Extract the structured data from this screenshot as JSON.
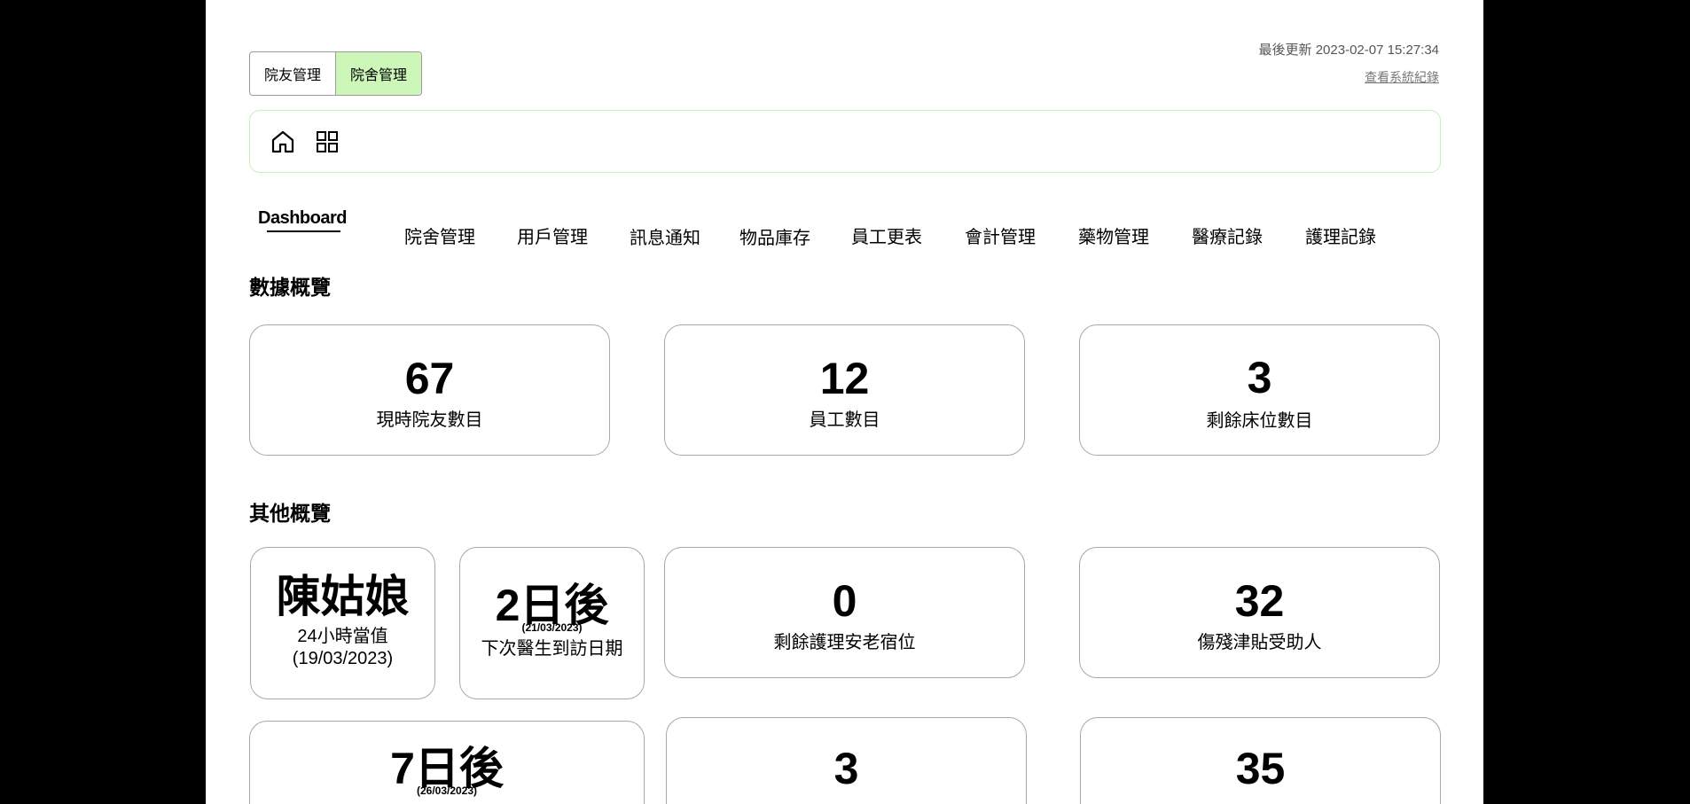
{
  "header": {
    "mode_tabs": [
      "院友管理",
      "院舍管理"
    ],
    "active_mode": "院舍管理",
    "last_update": "最後更新 2023-02-07 15:27:34",
    "system_log_link": "查看系統紀錄"
  },
  "icons": [
    "home-icon",
    "grid-icon"
  ],
  "nav": {
    "items": [
      "Dashboard",
      "院舍管理",
      "用戶管理",
      "訊息通知",
      "物品庫存",
      "員工更表",
      "會計管理",
      "藥物管理",
      "醫療記錄",
      "護理記錄"
    ],
    "active": "Dashboard"
  },
  "overview": {
    "title": "數據概覽",
    "cards": [
      {
        "value": "67",
        "label": "現時院友數目"
      },
      {
        "value": "12",
        "label": "員工數目"
      },
      {
        "value": "3",
        "label": "剩餘床位數目"
      }
    ]
  },
  "others": {
    "title": "其他概覽",
    "on_duty": {
      "value": "陳姑娘",
      "label_line1": "24小時當值",
      "label_line2": "(19/03/2023)"
    },
    "doctor_visit": {
      "value": "2日後",
      "date": "(21/03/2023)",
      "label": "下次醫生到訪日期"
    },
    "nursing_beds": {
      "value": "0",
      "label": "剩餘護理安老宿位"
    },
    "disability": {
      "value": "32",
      "label": "傷殘津貼受助人"
    },
    "row3_card1": {
      "value": "7日後",
      "date": "(26/03/2023)"
    },
    "row3_card2": {
      "value": "3"
    },
    "row3_card3": {
      "value": "35"
    }
  },
  "colors": {
    "accent_green": "#ccf7b8",
    "border_green": "#c7f3b4",
    "border_gray": "#a8a8a8"
  }
}
